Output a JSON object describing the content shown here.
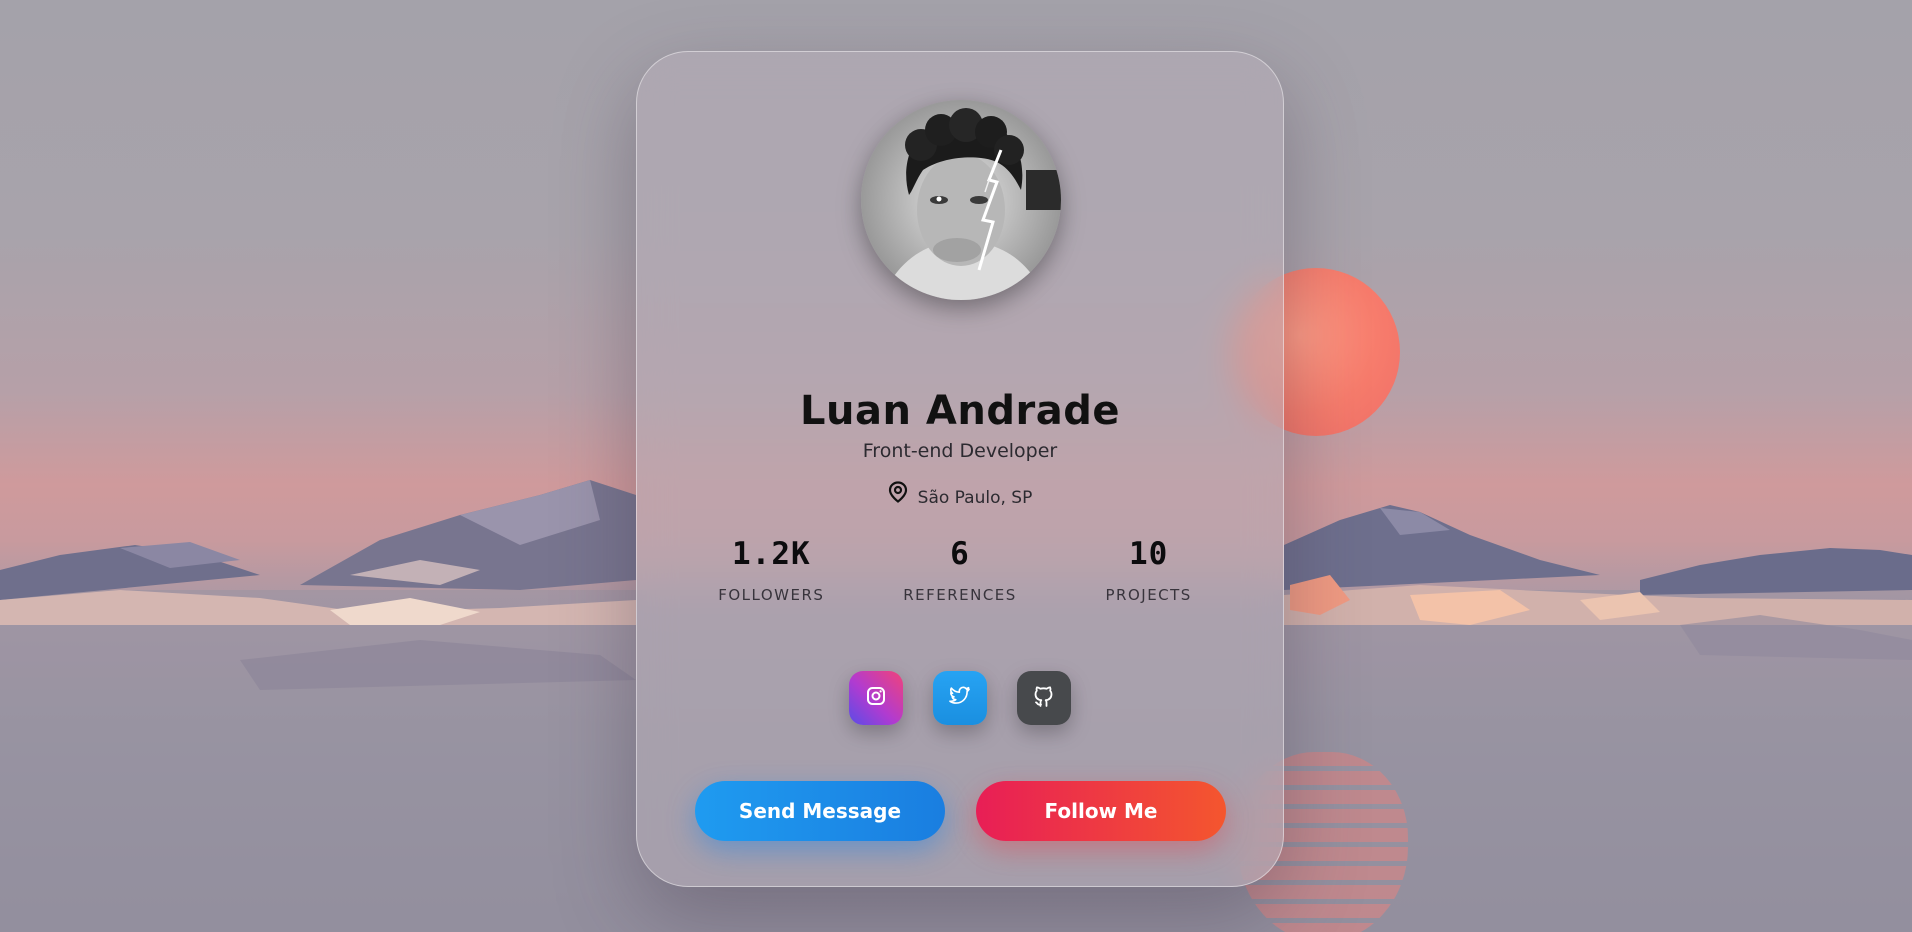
{
  "profile": {
    "name": "Luan Andrade",
    "role": "Front-end Developer",
    "location": "São Paulo, SP"
  },
  "stats": [
    {
      "value": "1.2K",
      "label": "FOLLOWERS"
    },
    {
      "value": "6",
      "label": "REFERENCES"
    },
    {
      "value": "10",
      "label": "PROJECTS"
    }
  ],
  "socials": [
    {
      "icon": "instagram-icon"
    },
    {
      "icon": "twitter-icon"
    },
    {
      "icon": "github-icon"
    }
  ],
  "actions": {
    "send_message": "Send Message",
    "follow": "Follow Me"
  },
  "colors": {
    "send_button": "#1f9bf0",
    "follow_button": "#e81e56",
    "sun": "#f77c6c"
  }
}
